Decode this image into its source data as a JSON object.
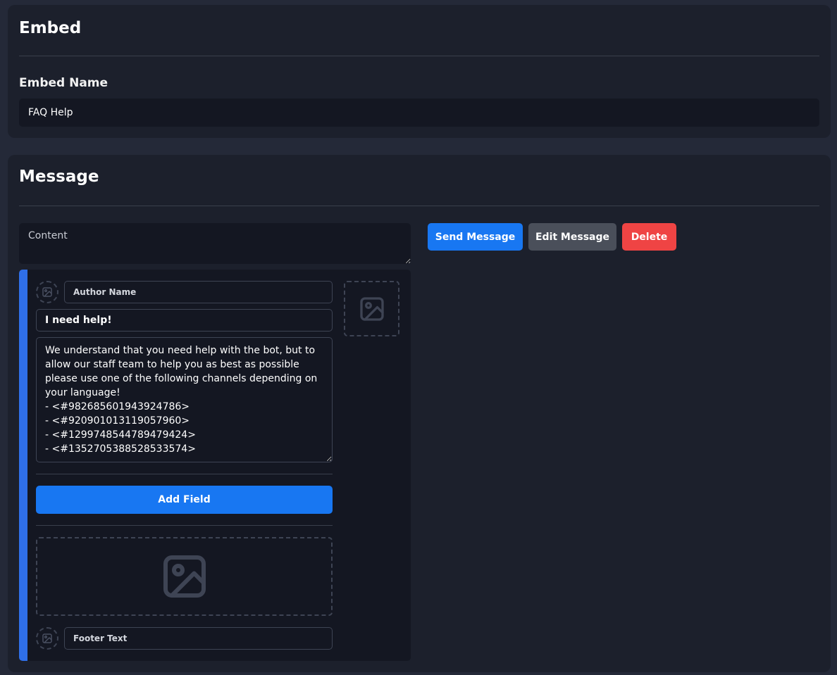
{
  "embed_section": {
    "title": "Embed",
    "name_label": "Embed Name",
    "name_value": "FAQ Help"
  },
  "message_section": {
    "title": "Message",
    "content_placeholder": "Content",
    "buttons": {
      "send": "Send Message",
      "edit": "Edit Message",
      "delete": "Delete"
    },
    "embed": {
      "accent_color": "#2f6fe8",
      "author_placeholder": "Author Name",
      "title_value": "I need help!",
      "description_value": "We understand that you need help with the bot, but to allow our staff team to help you as best as possible please use one of the following channels depending on your language!\n- <#982685601943924786>\n- <#920901013119057960>\n- <#1299748544789479424>\n- <#1352705388528533574>",
      "add_field_label": "Add Field",
      "footer_placeholder": "Footer Text",
      "icons": {
        "author_icon": "image-icon",
        "thumbnail": "image-icon",
        "image": "image-icon",
        "footer_icon": "image-icon"
      }
    }
  },
  "colors": {
    "page_bg": "#242938",
    "card_bg": "#1c202c",
    "input_bg": "#141722",
    "primary": "#1877f2",
    "secondary": "#4a4f5a",
    "danger": "#ef4444"
  }
}
